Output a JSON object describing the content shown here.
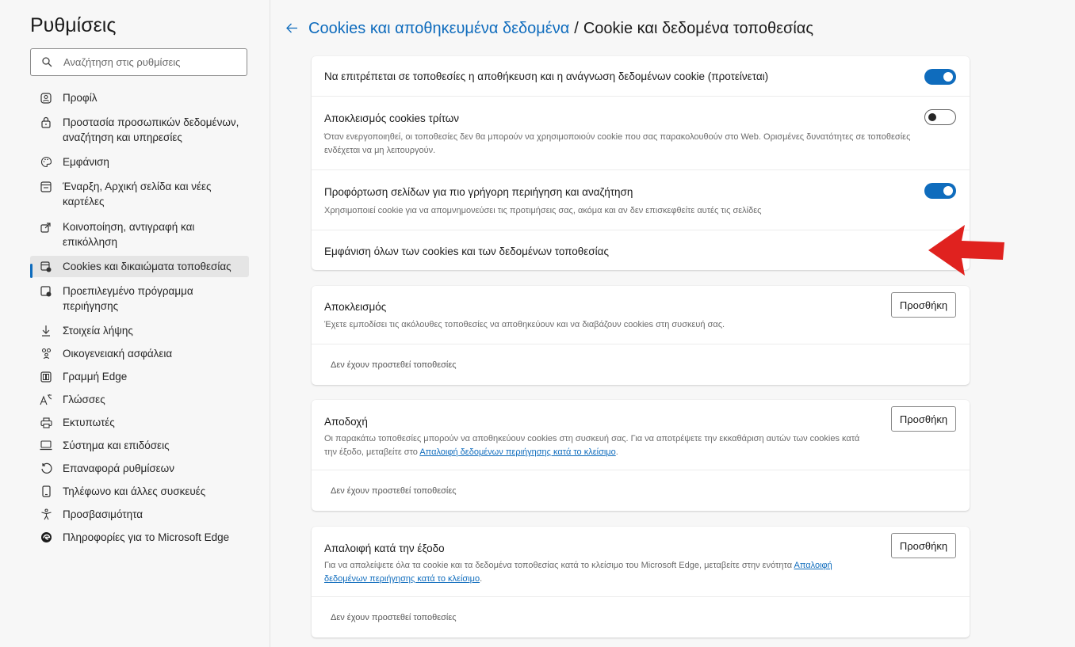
{
  "sidebar": {
    "title": "Ρυθμίσεις",
    "search_placeholder": "Αναζήτηση στις ρυθμίσεις",
    "items": [
      {
        "label": "Προφίλ",
        "icon": "profile-icon"
      },
      {
        "label": "Προστασία προσωπικών δεδομένων, αναζήτηση και υπηρεσίες",
        "icon": "lock-icon"
      },
      {
        "label": "Εμφάνιση",
        "icon": "palette-icon"
      },
      {
        "label": "Έναρξη, Αρχική σελίδα και νέες καρτέλες",
        "icon": "home-tabs-icon"
      },
      {
        "label": "Κοινοποίηση, αντιγραφή και επικόλληση",
        "icon": "share-icon"
      },
      {
        "label": "Cookies και δικαιώματα τοποθεσίας",
        "icon": "cookies-permissions-icon",
        "active": true
      },
      {
        "label": "Προεπιλεγμένο πρόγραμμα περιήγησης",
        "icon": "default-browser-icon"
      },
      {
        "label": "Στοιχεία λήψης",
        "icon": "download-icon"
      },
      {
        "label": "Οικογενειακή ασφάλεια",
        "icon": "family-icon"
      },
      {
        "label": "Γραμμή Edge",
        "icon": "edge-bar-icon"
      },
      {
        "label": "Γλώσσες",
        "icon": "languages-icon"
      },
      {
        "label": "Εκτυπωτές",
        "icon": "printer-icon"
      },
      {
        "label": "Σύστημα και επιδόσεις",
        "icon": "laptop-icon"
      },
      {
        "label": "Επαναφορά ρυθμίσεων",
        "icon": "reset-icon"
      },
      {
        "label": "Τηλέφωνο και άλλες συσκευές",
        "icon": "phone-icon"
      },
      {
        "label": "Προσβασιμότητα",
        "icon": "accessibility-icon"
      },
      {
        "label": "Πληροφορίες για το Microsoft Edge",
        "icon": "edge-logo-icon"
      }
    ]
  },
  "header": {
    "back_icon": "back-arrow-icon",
    "parent_label": "Cookies και αποθηκευμένα δεδομένα",
    "separator": "/",
    "current_label": "Cookie και δεδομένα τοποθεσίας"
  },
  "settings": {
    "allow_cookies": {
      "title": "Να επιτρέπεται σε τοποθεσίες η αποθήκευση και η ανάγνωση δεδομένων cookie (προτείνεται)",
      "enabled": true
    },
    "block_third_party": {
      "title": "Αποκλεισμός cookies τρίτων",
      "description": "Όταν ενεργοποιηθεί, οι τοποθεσίες δεν θα μπορούν να χρησιμοποιούν cookie που σας παρακολουθούν στο Web. Ορισμένες δυνατότητες σε τοποθεσίες ενδέχεται να μη λειτουργούν.",
      "enabled": false
    },
    "preload": {
      "title": "Προφόρτωση σελίδων για πιο γρήγορη περιήγηση και αναζήτηση",
      "description": "Χρησιμοποιεί cookie για να απομνημονεύσει τις προτιμήσεις σας, ακόμα και αν δεν επισκεφθείτε αυτές τις σελίδες",
      "enabled": true
    },
    "see_all": {
      "title": "Εμφάνιση όλων των cookies και των δεδομένων τοποθεσίας"
    }
  },
  "block_section": {
    "title": "Αποκλεισμός",
    "description": "Έχετε εμποδίσει τις ακόλουθες τοποθεσίες να αποθηκεύουν και να διαβάζουν cookies στη συσκευή σας.",
    "button": "Προσθήκη",
    "empty": "Δεν έχουν προστεθεί τοποθεσίες"
  },
  "allow_section": {
    "title": "Αποδοχή",
    "description": "Οι παρακάτω τοποθεσίες μπορούν να αποθηκεύουν cookies στη συσκευή σας. Για να αποτρέψετε την εκκαθάριση αυτών των cookies κατά την έξοδο, μεταβείτε στο ",
    "link": "Απαλοιφή δεδομένων περιήγησης κατά το κλείσιμο",
    "description_end": ".",
    "button": "Προσθήκη",
    "empty": "Δεν έχουν προστεθεί τοποθεσίες"
  },
  "clear_section": {
    "title": "Απαλοιφή κατά την έξοδο",
    "description": "Για να απαλείψετε όλα τα cookie και τα δεδομένα τοποθεσίας κατά το κλείσιμο του Microsoft Edge, μεταβείτε στην ενότητα ",
    "link": "Απαλοιφή δεδομένων περιήγησης κατά το κλείσιμο",
    "description_end": ".",
    "button": "Προσθήκη",
    "empty": "Δεν έχουν προστεθεί τοποθεσίες"
  },
  "colors": {
    "accent": "#0f6cbd",
    "annotation_arrow": "#e0221f"
  }
}
